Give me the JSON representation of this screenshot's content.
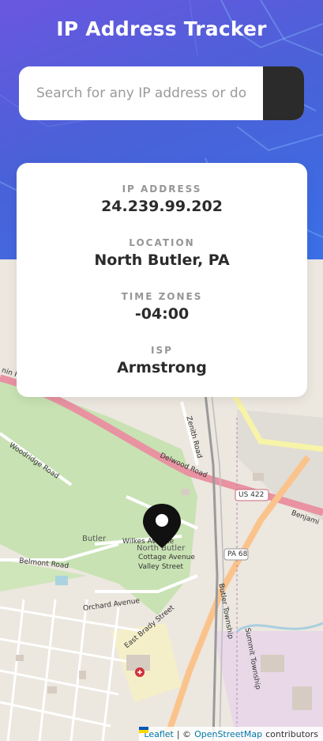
{
  "header": {
    "title": "IP Address Tracker"
  },
  "search": {
    "placeholder": "Search for any IP address or domain"
  },
  "info": {
    "ip_label": "IP ADDRESS",
    "ip_value": "24.239.99.202",
    "location_label": "LOCATION",
    "location_value": "North Butler, PA",
    "timezone_label": "TIME ZONES",
    "timezone_value": "-04:00",
    "isp_label": "ISP",
    "isp_value": "Armstrong"
  },
  "map": {
    "labels": {
      "franklin_hwy": "nin Franklin Highway",
      "woodridge": "Woodridge Road",
      "delwood": "Delwood Road",
      "zenith": "Zenith Road",
      "us422": "US 422",
      "benjamin": "Benjami",
      "butler": "Butler",
      "wilkes": "Wilkes Avenue",
      "north_butler": "North Butler",
      "cottage": "Cottage Avenue",
      "valley": "Valley Street",
      "pa68": "PA 68",
      "belmont": "Belmont Road",
      "orchard": "Orchard Avenue",
      "east_brady": "East Brady Street",
      "butler_township": "Butler Township",
      "summit_township": "Summit Township"
    }
  },
  "attribution": {
    "leaflet": "Leaflet",
    "separator": "| ©",
    "osm": "OpenStreetMap",
    "contributors": "contributors"
  },
  "colors": {
    "hero_start": "#6a57e0",
    "hero_end": "#3a6fe6",
    "dark": "#2b2b2b",
    "label_gray": "#969696"
  }
}
